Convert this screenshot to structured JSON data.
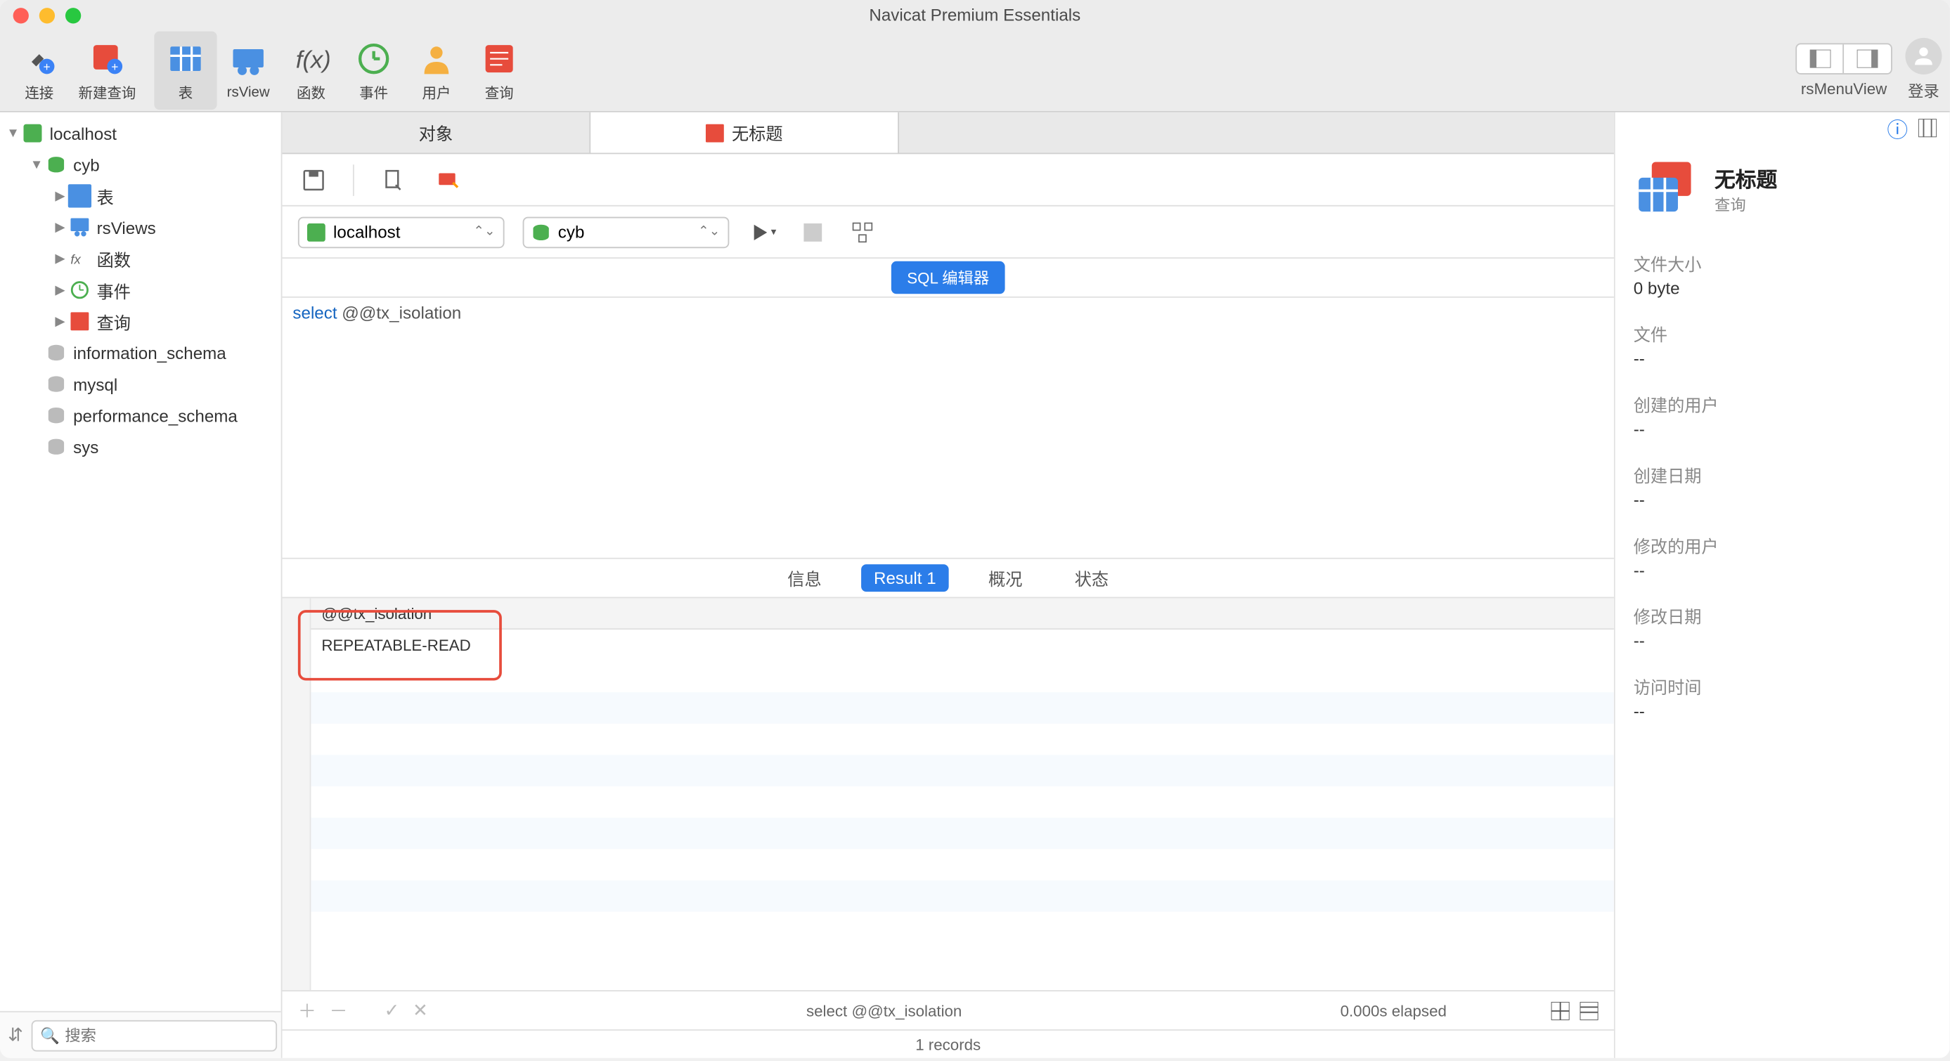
{
  "title": "Navicat Premium Essentials",
  "toolbar": {
    "items": [
      {
        "label": "连接",
        "icon": "plug"
      },
      {
        "label": "新建查询",
        "icon": "query-new"
      },
      {
        "label": "表",
        "icon": "table",
        "active": true
      },
      {
        "label": "rsView",
        "icon": "view"
      },
      {
        "label": "函数",
        "icon": "fx"
      },
      {
        "label": "事件",
        "icon": "clock"
      },
      {
        "label": "用户",
        "icon": "user"
      },
      {
        "label": "查询",
        "icon": "query"
      }
    ],
    "rsMenuView": "rsMenuView",
    "login": "登录"
  },
  "sidebar": {
    "connection": "localhost",
    "db_open": "cyb",
    "children": [
      "表",
      "rsViews",
      "函数",
      "事件",
      "查询"
    ],
    "other_dbs": [
      "information_schema",
      "mysql",
      "performance_schema",
      "sys"
    ],
    "search_placeholder": "搜索"
  },
  "tabs": {
    "objects": "对象",
    "untitled": "无标题"
  },
  "connection_row": {
    "conn": "localhost",
    "db": "cyb"
  },
  "sql_badge": "SQL 编辑器",
  "editor": {
    "keyword": "select",
    "rest": " @@tx_isolation"
  },
  "result_tabs": {
    "info": "信息",
    "result1": "Result 1",
    "profile": "概况",
    "status": "状态"
  },
  "grid": {
    "column": "@@tx_isolation",
    "value": "REPEATABLE-READ"
  },
  "status": {
    "sql": "select @@tx_isolation",
    "elapsed": "0.000s elapsed",
    "records": "1 records"
  },
  "rightpane": {
    "title": "无标题",
    "subtitle": "查询",
    "props": [
      {
        "label": "文件大小",
        "value": "0 byte"
      },
      {
        "label": "文件",
        "value": "--"
      },
      {
        "label": "创建的用户",
        "value": "--"
      },
      {
        "label": "创建日期",
        "value": "--"
      },
      {
        "label": "修改的用户",
        "value": "--"
      },
      {
        "label": "修改日期",
        "value": "--"
      },
      {
        "label": "访问时间",
        "value": "--"
      }
    ]
  }
}
